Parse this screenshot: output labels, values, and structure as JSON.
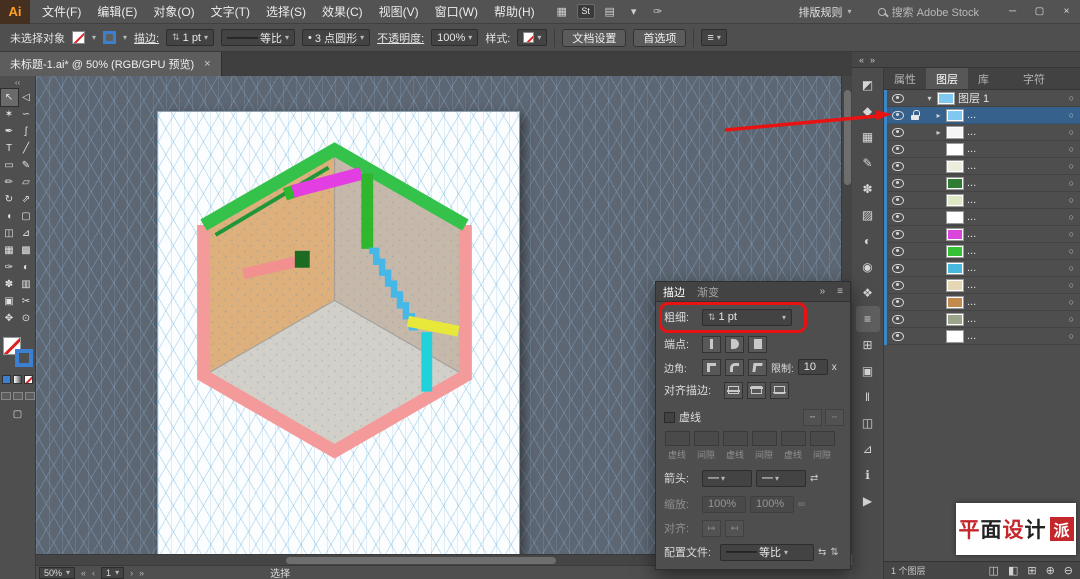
{
  "app": {
    "logo_text": "Ai"
  },
  "menubar": {
    "items": [
      "文件(F)",
      "编辑(E)",
      "对象(O)",
      "文字(T)",
      "选择(S)",
      "效果(C)",
      "视图(V)",
      "窗口(W)",
      "帮助(H)"
    ],
    "app_icons": [
      {
        "name": "arrange-documents-icon",
        "glyph": "▦"
      },
      {
        "name": "stock-badge",
        "glyph": "St",
        "badge": true
      },
      {
        "name": "workspace-switcher-icon",
        "glyph": "▤"
      },
      {
        "name": "workspace-caret-icon",
        "glyph": "▾"
      },
      {
        "name": "touch-workspace-icon",
        "glyph": "✑"
      }
    ],
    "arrange_label": "排版规则",
    "search_label": "搜索 Adobe Stock",
    "window": {
      "minimize": "─",
      "maximize": "▢",
      "close": "×"
    }
  },
  "controlbar": {
    "no_selection": "未选择对象",
    "stroke_label": "描边:",
    "stroke_value": "1 pt",
    "profile_value": "等比",
    "brush_value": "3 点圆形",
    "opacity_label": "不透明度:",
    "opacity_value": "100%",
    "style_label": "样式:",
    "doc_setup_label": "文档设置",
    "preferences_label": "首选项"
  },
  "doc_tab": {
    "title": "未标题-1.ai* @ 50% (RGB/GPU 预览)",
    "close": "×"
  },
  "toolbar": {
    "tools": [
      {
        "name": "selection-tool",
        "glyph": "↖",
        "active": true
      },
      {
        "name": "direct-selection-tool",
        "glyph": "◁"
      },
      {
        "name": "magic-wand-tool",
        "glyph": "✶"
      },
      {
        "name": "lasso-tool",
        "glyph": "∽"
      },
      {
        "name": "pen-tool",
        "glyph": "✒"
      },
      {
        "name": "curvature-tool",
        "glyph": "ʃ"
      },
      {
        "name": "type-tool",
        "glyph": "T"
      },
      {
        "name": "line-segment-tool",
        "glyph": "╱"
      },
      {
        "name": "rectangle-tool",
        "glyph": "▭"
      },
      {
        "name": "paintbrush-tool",
        "glyph": "✎"
      },
      {
        "name": "shaper-tool",
        "glyph": "✏"
      },
      {
        "name": "eraser-tool",
        "glyph": "▱"
      },
      {
        "name": "rotate-tool",
        "glyph": "↻"
      },
      {
        "name": "scale-tool",
        "glyph": "⇗"
      },
      {
        "name": "width-tool",
        "glyph": "◖"
      },
      {
        "name": "free-transform-tool",
        "glyph": "▢"
      },
      {
        "name": "shape-builder-tool",
        "glyph": "◫"
      },
      {
        "name": "perspective-grid-tool",
        "glyph": "⊿"
      },
      {
        "name": "mesh-tool",
        "glyph": "▦"
      },
      {
        "name": "gradient-tool",
        "glyph": "▩"
      },
      {
        "name": "eyedropper-tool",
        "glyph": "✑"
      },
      {
        "name": "blend-tool",
        "glyph": "◐"
      },
      {
        "name": "symbol-sprayer-tool",
        "glyph": "✽"
      },
      {
        "name": "column-graph-tool",
        "glyph": "▥"
      },
      {
        "name": "artboard-tool",
        "glyph": "▣"
      },
      {
        "name": "slice-tool",
        "glyph": "✂"
      },
      {
        "name": "hand-tool",
        "glyph": "✥"
      },
      {
        "name": "zoom-tool",
        "glyph": "⊙"
      }
    ]
  },
  "stroke_panel": {
    "tab_stroke": "描边",
    "tab_gradient": "渐变",
    "weight_label": "粗细:",
    "weight_value": "1 pt",
    "cap_label": "端点:",
    "corner_label": "边角:",
    "limit_label": "限制:",
    "limit_value": "10",
    "limit_unit": "x",
    "align_label": "对齐描边:",
    "dashed_label": "虚线",
    "dash_fields": [
      {
        "label": "虚线"
      },
      {
        "label": "间隙"
      },
      {
        "label": "虚线"
      },
      {
        "label": "间隙"
      },
      {
        "label": "虚线"
      },
      {
        "label": "间隙"
      }
    ],
    "arrow_label": "箭头:",
    "scale_label": "缩放:",
    "scale_left": "100%",
    "scale_right": "100%",
    "align2_label": "对齐:",
    "profile_label": "配置文件:",
    "profile_value": "等比"
  },
  "dock_icons": [
    {
      "name": "color-panel-icon",
      "glyph": "◩"
    },
    {
      "name": "color-guide-panel-icon",
      "glyph": "◆"
    },
    {
      "name": "swatches-panel-icon",
      "glyph": "▦"
    },
    {
      "name": "brushes-panel-icon",
      "glyph": "✎"
    },
    {
      "name": "symbols-panel-icon",
      "glyph": "✽"
    },
    {
      "name": "gradient-panel-icon",
      "glyph": "▨"
    },
    {
      "name": "transparency-panel-icon",
      "glyph": "◐"
    },
    {
      "name": "appearance-panel-icon",
      "glyph": "◉"
    },
    {
      "name": "graphic-styles-panel-icon",
      "glyph": "❖"
    },
    {
      "name": "stroke-panel-icon",
      "glyph": "≡",
      "active": true
    },
    {
      "name": "layers-panel-icon",
      "glyph": "⊞"
    },
    {
      "name": "artboards-panel-icon",
      "glyph": "▣"
    },
    {
      "name": "align-panel-icon",
      "glyph": "‖"
    },
    {
      "name": "pathfinder-panel-icon",
      "glyph": "◫"
    },
    {
      "name": "transform-panel-icon",
      "glyph": "⊿"
    },
    {
      "name": "info-panel-icon",
      "glyph": "ℹ"
    },
    {
      "name": "actions-panel-icon",
      "glyph": "▶"
    }
  ],
  "layers_panel": {
    "tabs": [
      {
        "label": "属性"
      },
      {
        "label": "图层",
        "active": true
      },
      {
        "label": "库"
      },
      {
        "label": "字符",
        "gap": true
      }
    ],
    "rows": [
      {
        "label": "图层 1",
        "chevron": "▾",
        "thumb": "#7ec8f2",
        "lock": false,
        "selected": false,
        "child": false
      },
      {
        "label": "...",
        "chevron": "▸",
        "thumb": "#7ec8f2",
        "lock": true,
        "selected": true,
        "child": true
      },
      {
        "label": "...",
        "chevron": "▸",
        "thumb": "#f5f5f5",
        "lock": false,
        "selected": false,
        "child": true
      },
      {
        "label": "...",
        "chevron": "",
        "thumb": "#ffffff",
        "lock": false,
        "selected": false,
        "child": true
      },
      {
        "label": "...",
        "chevron": "",
        "thumb": "#ececdf",
        "lock": false,
        "selected": false,
        "child": true
      },
      {
        "label": "...",
        "chevron": "",
        "thumb": "#2e7d32",
        "lock": false,
        "selected": false,
        "child": true
      },
      {
        "label": "...",
        "chevron": "",
        "thumb": "#dfe8c4",
        "lock": false,
        "selected": false,
        "child": true
      },
      {
        "label": "...",
        "chevron": "",
        "thumb": "#ffffff",
        "lock": false,
        "selected": false,
        "child": true
      },
      {
        "label": "...",
        "chevron": "",
        "thumb": "#d946d9",
        "lock": false,
        "selected": false,
        "child": true
      },
      {
        "label": "...",
        "chevron": "",
        "thumb": "#35c135",
        "lock": false,
        "selected": false,
        "child": true
      },
      {
        "label": "...",
        "chevron": "",
        "thumb": "#46b9dc",
        "lock": false,
        "selected": false,
        "child": true
      },
      {
        "label": "...",
        "chevron": "",
        "thumb": "#e6d6b4",
        "lock": false,
        "selected": false,
        "child": true
      },
      {
        "label": "...",
        "chevron": "",
        "thumb": "#c28a4c",
        "lock": false,
        "selected": false,
        "child": true
      },
      {
        "label": "...",
        "chevron": "",
        "thumb": "#9aa58c",
        "lock": false,
        "selected": false,
        "child": true
      },
      {
        "label": "...",
        "chevron": "",
        "thumb": "#ffffff",
        "lock": false,
        "selected": false,
        "child": true
      }
    ],
    "footer_count": "1 个图层",
    "footer_icons": [
      {
        "name": "collect-for-export-icon",
        "glyph": "◫"
      },
      {
        "name": "make-mask-icon",
        "glyph": "◧"
      },
      {
        "name": "new-sublayer-icon",
        "glyph": "⊞"
      },
      {
        "name": "new-layer-icon",
        "glyph": "⊕"
      },
      {
        "name": "delete-layer-icon",
        "glyph": "⊖"
      }
    ]
  },
  "statusbar": {
    "zoom": "50%",
    "artboard_nav": "1",
    "status": "选择"
  },
  "icons": {
    "caret": "▾",
    "stepper": "⇅",
    "swap": "⇄",
    "link": "∞",
    "flip_h": "⇆",
    "flip_v": "⇅",
    "dash_a": "╍",
    "dash_b": "╌",
    "panel_collapse": "»",
    "panel_more": "≡",
    "double_left": "«",
    "double_right": "»",
    "nav_first": "«",
    "nav_prev": "‹",
    "nav_next": "›",
    "nav_last": "»",
    "target_circle": "○",
    "collapse": "‹‹",
    "line": "———",
    "bullet": "•",
    "align_start": "↤",
    "align_end": "↦"
  },
  "annotations": {
    "arrow_color": "#e81212",
    "highlight_color": "#e81212"
  },
  "artwork": {
    "colors": {
      "pink": "#f59a9a",
      "green": "#35c24a",
      "green_dark": "#1f9638",
      "wall_left": "#dcaa72",
      "wall_right": "#c2b4a4",
      "floor": "#cfccc4",
      "magenta": "#e23ee2",
      "post_green": "#2db82d",
      "stairs_cyan": "#45b8e8",
      "yellow": "#e8e83a",
      "cyan": "#22d2da",
      "ledge_pink": "#f29090",
      "cube_green": "#1d6b22",
      "edge": "#9a9aa0"
    }
  },
  "watermark": {
    "chars": [
      {
        "ch": "平",
        "color": "#c3272b"
      },
      {
        "ch": "面",
        "color": "#222222"
      },
      {
        "ch": "设",
        "color": "#c3272b"
      },
      {
        "ch": "计",
        "color": "#222222"
      }
    ],
    "badge": "派",
    "badge_bg": "#c3272b"
  }
}
